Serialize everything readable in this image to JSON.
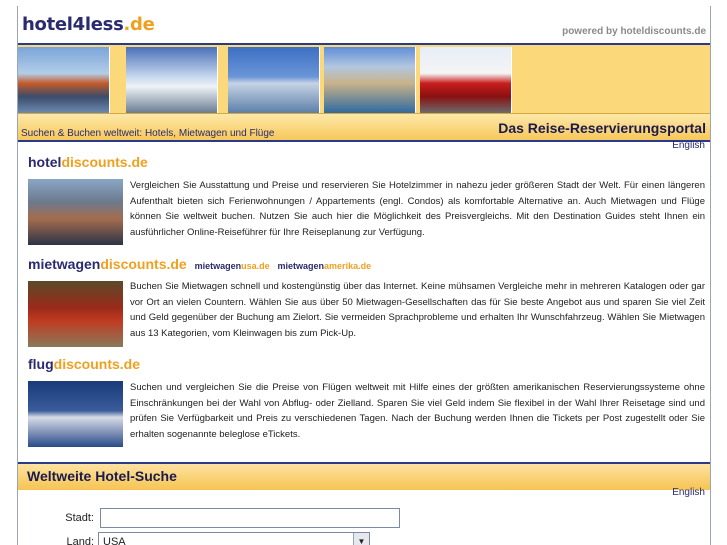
{
  "header": {
    "logo_main": "hotel4less",
    "logo_tld": ".de",
    "powered_by": "powered by hoteldiscounts.de"
  },
  "tagline": {
    "left": "Suchen & Buchen weltweit: Hotels, Mietwagen und Flüge",
    "right": "Das Reise-Reservierungsportal"
  },
  "lang_link": "English",
  "sections": {
    "hotel": {
      "title_main": "hotel",
      "title_hl": "discounts.de",
      "text": "Vergleichen Sie Ausstattung und Preise und reservieren Sie Hotelzimmer in nahezu jeder größeren Stadt der Welt. Für einen längeren Aufenthalt bieten sich Ferienwohnungen / Appartements (engl. Condos) als komfortable Alternative an. Auch Mietwagen und Flüge können Sie weltweit buchen. Nutzen Sie auch hier die Möglichkeit des Preisvergleichs. Mit den Destination Guides steht Ihnen ein ausführlicher Online-Reiseführer für Ihre Reiseplanung zur Verfügung."
    },
    "car": {
      "title_main": "mietwagen",
      "title_hl": "discounts.de",
      "sub1_main": "mietwagen",
      "sub1_hl": "usa.de",
      "sub2_main": "mietwagen",
      "sub2_hl": "amerika.de",
      "text": "Buchen Sie Mietwagen schnell und kostengünstig über das Internet. Keine mühsamen Vergleiche mehr in mehreren Katalogen oder gar vor Ort an vielen Countern. Wählen Sie aus über 50 Mietwagen-Gesellschaften das für Sie beste Angebot aus und sparen Sie viel Zeit und Geld gegenüber der Buchung am Zielort. Sie vermeiden Sprachprobleme und erhalten Ihr Wunschfahrzeug. Wählen Sie Mietwagen aus 13 Kategorien, vom Kleinwagen bis zum Pick-Up."
    },
    "flight": {
      "title_main": "flug",
      "title_hl": "discounts.de",
      "text": "Suchen und vergleichen Sie die Preise von Flügen weltweit mit Hilfe eines der größten amerikanischen Reservierungssysteme ohne Einschränkungen bei der Wahl von Abflug- oder Zielland. Sparen Sie viel Geld indem Sie flexibel in der Wahl Ihrer Reisetage sind und prüfen Sie Verfügbarkeit und Preis zu verschiedenen Tagen. Nach der Buchung werden Ihnen die Tickets per Post zugestellt oder Sie erhalten sogenannte beleglose eTickets."
    }
  },
  "search": {
    "title": "Weltweite Hotel-Suche",
    "city_label": "Stadt:",
    "city_value": "",
    "country_label": "Land:",
    "country_value": "USA"
  }
}
